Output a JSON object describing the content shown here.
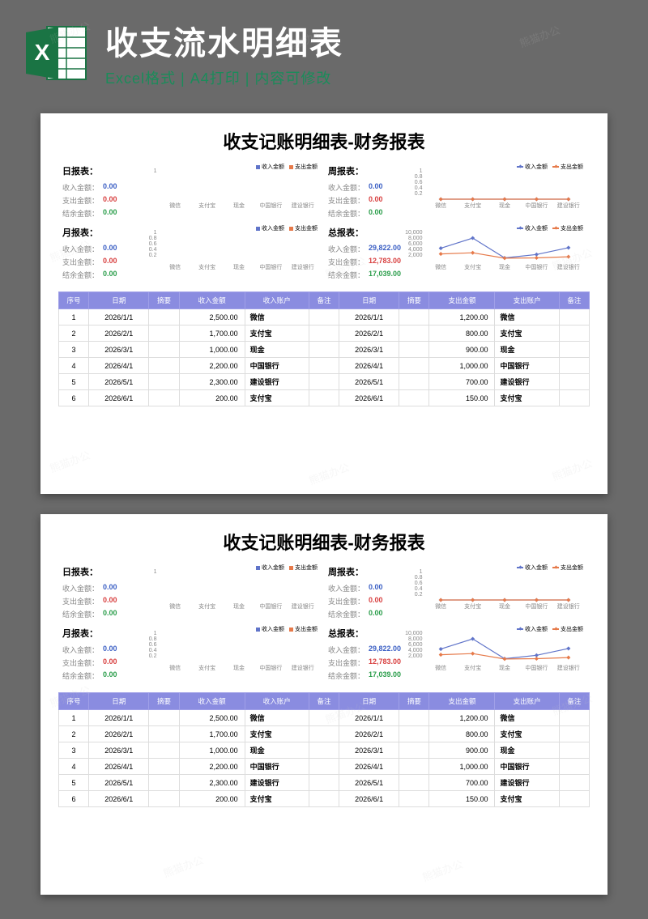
{
  "header": {
    "title": "收支流水明细表",
    "subtitle": "Excel格式 | A4打印 | 内容可修改"
  },
  "page_title": "收支记账明细表-财务报表",
  "legend": {
    "income": "收入金额",
    "expense": "支出金额"
  },
  "reports": {
    "daily": {
      "name": "日报表：",
      "income_label": "收入金额：",
      "income": "0.00",
      "expense_label": "支出金额：",
      "expense": "0.00",
      "balance_label": "结余金额：",
      "balance": "0.00"
    },
    "weekly": {
      "name": "周报表：",
      "income_label": "收入金额：",
      "income": "0.00",
      "expense_label": "支出金额：",
      "expense": "0.00",
      "balance_label": "结余金额：",
      "balance": "0.00"
    },
    "monthly": {
      "name": "月报表：",
      "income_label": "收入金额：",
      "income": "0.00",
      "expense_label": "支出金额：",
      "expense": "0.00",
      "balance_label": "结余金额：",
      "balance": "0.00"
    },
    "total": {
      "name": "总报表：",
      "income_label": "收入金额：",
      "income": "29,822.00",
      "expense_label": "支出金额：",
      "expense": "12,783.00",
      "balance_label": "结余金额：",
      "balance": "17,039.00"
    }
  },
  "table": {
    "headers": [
      "序号",
      "日期",
      "摘要",
      "收入金额",
      "收入账户",
      "备注",
      "日期",
      "摘要",
      "支出金额",
      "支出账户",
      "备注"
    ],
    "rows": [
      {
        "idx": "1",
        "d1": "2026/1/1",
        "s1": "",
        "in": "2,500.00",
        "ia": "微信",
        "n1": "",
        "d2": "2026/1/1",
        "s2": "",
        "out": "1,200.00",
        "oa": "微信",
        "n2": ""
      },
      {
        "idx": "2",
        "d1": "2026/2/1",
        "s1": "",
        "in": "1,700.00",
        "ia": "支付宝",
        "n1": "",
        "d2": "2026/2/1",
        "s2": "",
        "out": "800.00",
        "oa": "支付宝",
        "n2": ""
      },
      {
        "idx": "3",
        "d1": "2026/3/1",
        "s1": "",
        "in": "1,000.00",
        "ia": "现金",
        "n1": "",
        "d2": "2026/3/1",
        "s2": "",
        "out": "900.00",
        "oa": "现金",
        "n2": ""
      },
      {
        "idx": "4",
        "d1": "2026/4/1",
        "s1": "",
        "in": "2,200.00",
        "ia": "中国银行",
        "n1": "",
        "d2": "2026/4/1",
        "s2": "",
        "out": "1,000.00",
        "oa": "中国银行",
        "n2": ""
      },
      {
        "idx": "5",
        "d1": "2026/5/1",
        "s1": "",
        "in": "2,300.00",
        "ia": "建设银行",
        "n1": "",
        "d2": "2026/5/1",
        "s2": "",
        "out": "700.00",
        "oa": "建设银行",
        "n2": ""
      },
      {
        "idx": "6",
        "d1": "2026/6/1",
        "s1": "",
        "in": "200.00",
        "ia": "支付宝",
        "n1": "",
        "d2": "2026/6/1",
        "s2": "",
        "out": "150.00",
        "oa": "支付宝",
        "n2": ""
      }
    ]
  },
  "chart_data": [
    {
      "type": "bar",
      "title": "日报表",
      "categories": [
        "微信",
        "支付宝",
        "现金",
        "中国银行",
        "建设银行"
      ],
      "series": [
        {
          "name": "收入金额",
          "values": [
            0,
            0,
            0,
            0,
            0
          ]
        },
        {
          "name": "支出金额",
          "values": [
            0,
            0,
            0,
            0,
            0
          ]
        }
      ],
      "ylim": [
        0,
        1
      ],
      "yticks": [
        1.0
      ]
    },
    {
      "type": "line",
      "title": "周报表",
      "categories": [
        "微信",
        "支付宝",
        "现金",
        "中国银行",
        "建设银行"
      ],
      "series": [
        {
          "name": "收入金额",
          "values": [
            0,
            0,
            0,
            0,
            0
          ]
        },
        {
          "name": "支出金额",
          "values": [
            0,
            0,
            0,
            0,
            0
          ]
        }
      ],
      "ylim": [
        0,
        1
      ],
      "yticks": [
        1.0,
        0.8,
        0.6,
        0.4,
        0.2
      ]
    },
    {
      "type": "bar",
      "title": "月报表",
      "categories": [
        "微信",
        "支付宝",
        "现金",
        "中国银行",
        "建设银行"
      ],
      "series": [
        {
          "name": "收入金额",
          "values": [
            0,
            0,
            0,
            0,
            0
          ]
        },
        {
          "name": "支出金额",
          "values": [
            0,
            0,
            0,
            0,
            0
          ]
        }
      ],
      "ylim": [
        0,
        1
      ],
      "yticks": [
        1.0,
        0.8,
        0.6,
        0.4,
        0.2
      ]
    },
    {
      "type": "line",
      "title": "总报表",
      "categories": [
        "微信",
        "支付宝",
        "现金",
        "中国银行",
        "建设银行"
      ],
      "series": [
        {
          "name": "收入金额",
          "values": [
            4400,
            8000,
            1000,
            2200,
            4600
          ]
        },
        {
          "name": "支出金额",
          "values": [
            2400,
            2800,
            900,
            1000,
            1400
          ]
        }
      ],
      "ylim": [
        0,
        10000
      ],
      "yticks": [
        10000,
        8000,
        6000,
        4000,
        2000
      ]
    }
  ],
  "watermark": "熊猫办公"
}
